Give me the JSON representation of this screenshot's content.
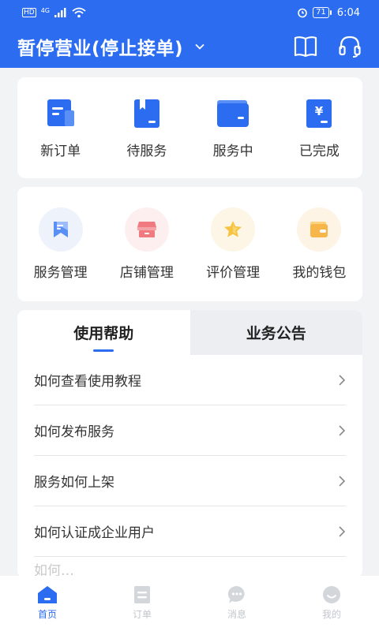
{
  "status_bar": {
    "signal_labels": [
      "HD",
      "4G"
    ],
    "battery": "71",
    "time": "6:04"
  },
  "header": {
    "title": "暂停营业(停止接单)"
  },
  "orders": [
    {
      "label": "新订单",
      "icon": "new-order-icon"
    },
    {
      "label": "待服务",
      "icon": "pending-service-icon"
    },
    {
      "label": "服务中",
      "icon": "in-service-icon"
    },
    {
      "label": "已完成",
      "icon": "completed-icon"
    }
  ],
  "tools": [
    {
      "label": "服务管理",
      "icon": "service-manage-icon"
    },
    {
      "label": "店铺管理",
      "icon": "shop-manage-icon"
    },
    {
      "label": "评价管理",
      "icon": "review-manage-icon"
    },
    {
      "label": "我的钱包",
      "icon": "wallet-icon"
    }
  ],
  "help": {
    "tabs": [
      "使用帮助",
      "业务公告"
    ],
    "items": [
      "如何查看使用教程",
      "如何发布服务",
      "服务如何上架",
      "如何认证成企业用户",
      "如何…"
    ]
  },
  "tabbar": [
    {
      "label": "首页",
      "icon": "home-icon"
    },
    {
      "label": "订单",
      "icon": "order-icon"
    },
    {
      "label": "消息",
      "icon": "message-icon"
    },
    {
      "label": "我的",
      "icon": "profile-icon"
    }
  ],
  "colors": {
    "brand": "#2b6cf0",
    "background": "#f2f3f5",
    "inactive": "#c3c6cc"
  }
}
